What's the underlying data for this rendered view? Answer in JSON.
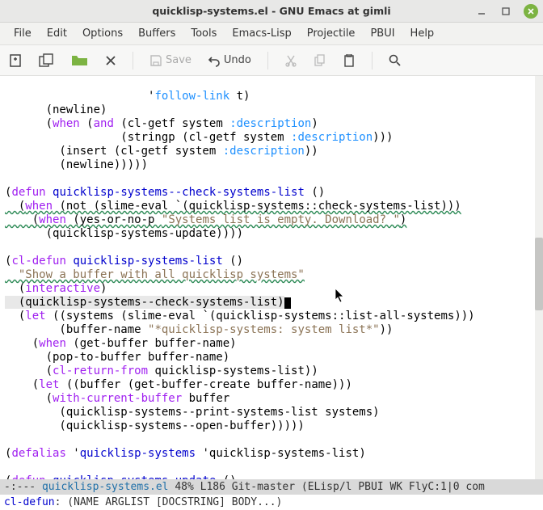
{
  "window": {
    "title": "quicklisp-systems.el - GNU Emacs at gimli"
  },
  "menu": {
    "file": "File",
    "edit": "Edit",
    "options": "Options",
    "buffers": "Buffers",
    "tools": "Tools",
    "emacs_lisp": "Emacs-Lisp",
    "projectile": "Projectile",
    "pbui": "PBUI",
    "help": "Help"
  },
  "toolbar": {
    "save_label": "Save",
    "undo_label": "Undo"
  },
  "code": {
    "l1a": "                     '",
    "l1b": "follow-link",
    "l1c": " t)",
    "l2": "      (newline)",
    "l3a": "      (",
    "l3when": "when",
    "l3b": " (",
    "l3and": "and",
    "l3c": " (cl-getf system ",
    "l3d": ":description",
    "l3e": ")",
    "l4a": "                 (stringp (cl-getf system ",
    "l4b": ":description",
    "l4c": ")))",
    "l5a": "        (insert (cl-getf system ",
    "l5b": ":description",
    "l5c": "))",
    "l6": "        (newline)))))",
    "l7": "",
    "l8a": "(",
    "l8defun": "defun",
    "l8b": " ",
    "l8fn": "quicklisp-systems--check-systems-list",
    "l8c": " ()",
    "l9a": "  (",
    "l9when": "when",
    "l9b": " (not (slime-eval `(quicklisp-systems::check-systems-list)))",
    "l10a": "    (",
    "l10when": "when",
    "l10b": " (yes-or-no-p ",
    "l10str": "\"Systems list is empty. Download? \"",
    "l10c": ")",
    "l11": "      (quicklisp-systems-update))))",
    "l12": "",
    "l13a": "(",
    "l13cldefun": "cl-defun",
    "l13b": " ",
    "l13fn": "quicklisp-systems-list",
    "l13c": " ()",
    "l14": "  \"Show a buffer with all quicklisp systems\"",
    "l15a": "  (",
    "l15int": "interactive",
    "l15b": ")",
    "l16": "  (quicklisp-systems--check-systems-list)",
    "l17a": "  (",
    "l17let": "let",
    "l17b": " ((systems (slime-eval `(quicklisp-systems::list-all-systems)))",
    "l18a": "        (buffer-name ",
    "l18str": "\"*quicklisp-systems: system list*\"",
    "l18b": "))",
    "l19a": "    (",
    "l19when": "when",
    "l19b": " (get-buffer buffer-name)",
    "l20": "      (pop-to-buffer buffer-name)",
    "l21a": "      (",
    "l21ret": "cl-return-from",
    "l21b": " quicklisp-systems-list))",
    "l22a": "    (",
    "l22let": "let",
    "l22b": " ((buffer (get-buffer-create buffer-name)))",
    "l23a": "      (",
    "l23wcb": "with-current-buffer",
    "l23b": " buffer",
    "l24": "        (quicklisp-systems--print-systems-list systems)",
    "l25": "        (quicklisp-systems--open-buffer)))))",
    "l26": "",
    "l27a": "(",
    "l27da": "defalias",
    "l27b": " '",
    "l27fn1": "quicklisp-systems",
    "l27c": " 'quicklisp-systems-list)",
    "l28": "",
    "l29a": "(",
    "l29defun": "defun",
    "l29b": " ",
    "l29fn": "quicklisp-systems-update",
    "l29c": " ()"
  },
  "modeline": {
    "prefix": "-:---  ",
    "buffer": "quicklisp-systems.el",
    "rest": "   48%   L186  Git-master  (ELisp/l PBUI WK FlyC:1|0 com"
  },
  "minibuffer": {
    "label": "cl-defun",
    "rest": ": (NAME ARGLIST [DOCSTRING] BODY...)"
  }
}
